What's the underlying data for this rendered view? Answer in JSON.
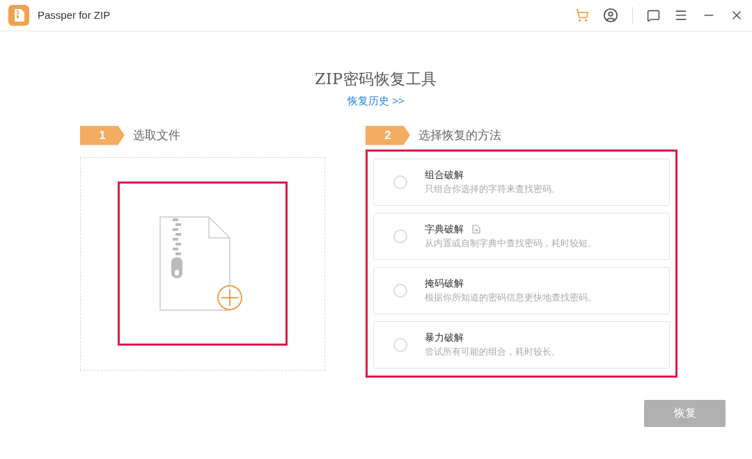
{
  "window": {
    "title": "Passper for ZIP"
  },
  "heading": "ZIP密码恢复工具",
  "history_link": "恢复历史 >>",
  "step1": {
    "number": "1",
    "label": "选取文件"
  },
  "step2": {
    "number": "2",
    "label": "选择恢复的方法"
  },
  "methods": [
    {
      "title": "组合破解",
      "description": "只组合你选择的字符来查找密码。",
      "selected": false,
      "has_import_icon": false
    },
    {
      "title": "字典破解",
      "description": "从内置或自制字典中查找密码，耗时较短。",
      "selected": false,
      "has_import_icon": true
    },
    {
      "title": "掩码破解",
      "description": "根据你所知道的密码信息更快地查找密码。",
      "selected": false,
      "has_import_icon": false
    },
    {
      "title": "暴力破解",
      "description": "尝试所有可能的组合，耗时较长。",
      "selected": false,
      "has_import_icon": false
    }
  ],
  "recover_button": {
    "label": "恢复",
    "disabled": true
  }
}
